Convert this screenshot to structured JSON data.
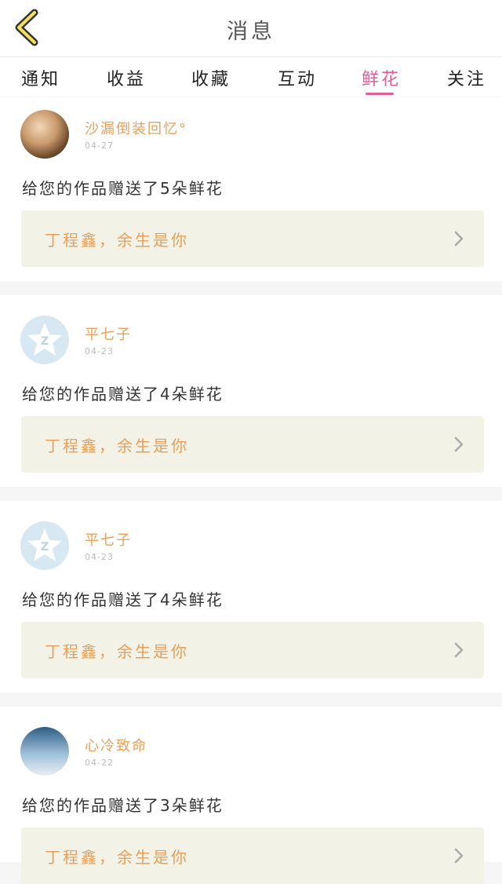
{
  "header": {
    "title": "消息",
    "back_icon": "chevron-left-icon"
  },
  "tabs": [
    {
      "label": "通知"
    },
    {
      "label": "收益"
    },
    {
      "label": "收藏"
    },
    {
      "label": "互动"
    },
    {
      "label": "鲜花",
      "active": true
    },
    {
      "label": "关注"
    }
  ],
  "colors": {
    "accent": "#e05f96",
    "name": "#e8a05a",
    "work_bg": "#f2f2e6"
  },
  "messages": [
    {
      "avatar": "photo-avatar",
      "name": "沙漏倒装回忆°",
      "time": "04-27",
      "text": "给您的作品赠送了5朵鲜花",
      "work": "丁程鑫，余生是你"
    },
    {
      "avatar": "default-avatar",
      "name": "平七子",
      "time": "04-23",
      "text": "给您的作品赠送了4朵鲜花",
      "work": "丁程鑫，余生是你"
    },
    {
      "avatar": "default-avatar",
      "name": "平七子",
      "time": "04-23",
      "text": "给您的作品赠送了4朵鲜花",
      "work": "丁程鑫，余生是你"
    },
    {
      "avatar": "photo-avatar",
      "name": "心冷致命",
      "time": "04-22",
      "text": "给您的作品赠送了3朵鲜花",
      "work": "丁程鑫，余生是你"
    }
  ]
}
